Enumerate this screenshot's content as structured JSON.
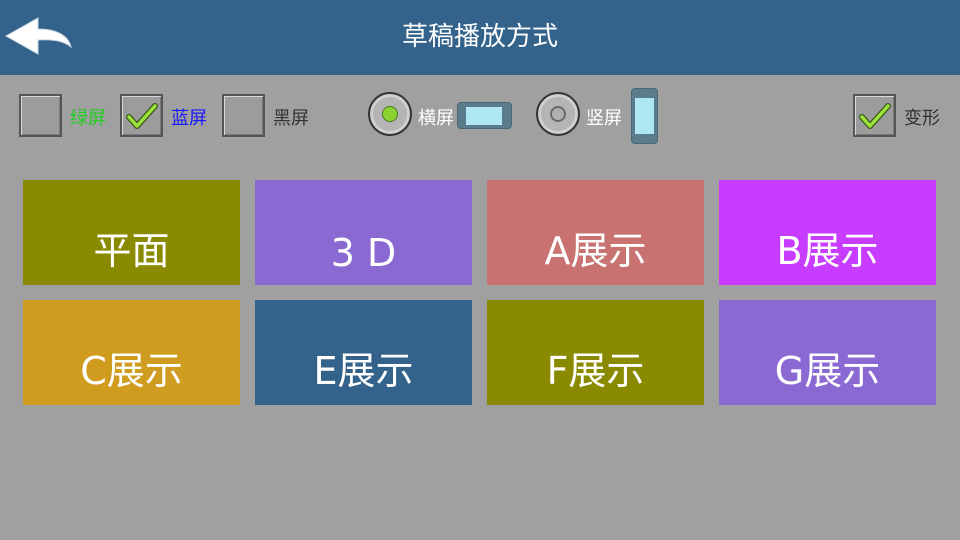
{
  "header": {
    "title": "草稿播放方式",
    "background": "#33628a",
    "back_icon": "back-arrow-icon"
  },
  "options": {
    "green_screen": {
      "label": "绿屏",
      "checked": false,
      "color": "#22cc22"
    },
    "blue_screen": {
      "label": "蓝屏",
      "checked": true,
      "color": "#1a1aff"
    },
    "black_screen": {
      "label": "黑屏",
      "checked": false,
      "color": "#333333"
    },
    "landscape": {
      "label": "横屏",
      "selected": true,
      "icon": "landscape-device-icon"
    },
    "portrait": {
      "label": "竖屏",
      "selected": false,
      "icon": "portrait-device-icon"
    },
    "deform": {
      "label": "变形",
      "checked": true,
      "color": "#333333"
    }
  },
  "tiles": [
    {
      "label": "平面",
      "color": "#8a8a00"
    },
    {
      "label": "3 D",
      "color": "#8a6ad2"
    },
    {
      "label": "A展示",
      "color": "#c87272"
    },
    {
      "label": "B展示",
      "color": "#c83cff"
    },
    {
      "label": "C展示",
      "color": "#d09c20"
    },
    {
      "label": "E展示",
      "color": "#33628a"
    },
    {
      "label": "F展示",
      "color": "#8a8a00"
    },
    {
      "label": "G展示",
      "color": "#8a6ad2"
    }
  ]
}
